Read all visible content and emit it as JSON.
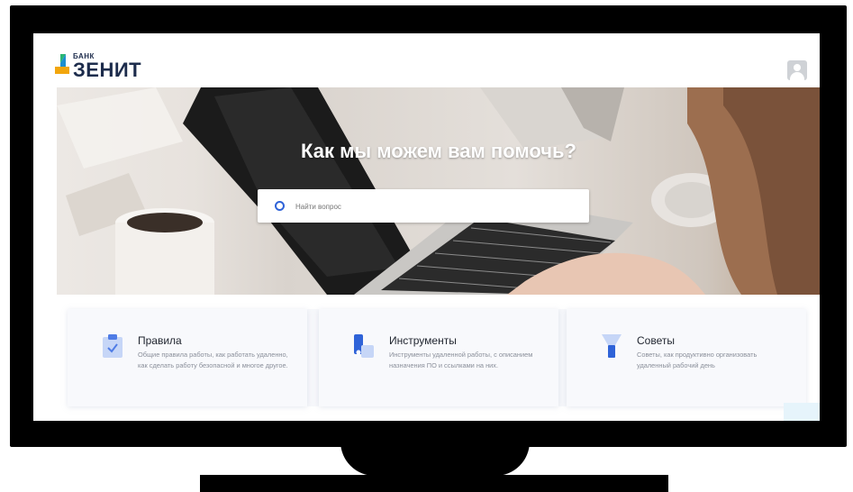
{
  "header": {
    "logo_small": "БАНК",
    "logo_big": "ЗЕНИТ"
  },
  "hero": {
    "title": "Как мы можем вам помочь?",
    "search_placeholder": "Найти вопрос"
  },
  "cards": [
    {
      "title": "Правила",
      "description": "Общие правила работы, как работать удаленно, как сделать работу безопасной и многое другое.",
      "icon": "clipboard-check-icon"
    },
    {
      "title": "Инструменты",
      "description": "Инструменты удаленной работы, с описанием назначения ПО и ссылками на них.",
      "icon": "tools-icon"
    },
    {
      "title": "Советы",
      "description": "Советы, как продуктивно организовать удаленный рабочий день",
      "icon": "lamp-icon"
    }
  ],
  "colors": {
    "brand_dark": "#1d2c4c",
    "brand_green": "#2bb673",
    "accent_blue": "#2f63d8",
    "frame": "#000000"
  }
}
